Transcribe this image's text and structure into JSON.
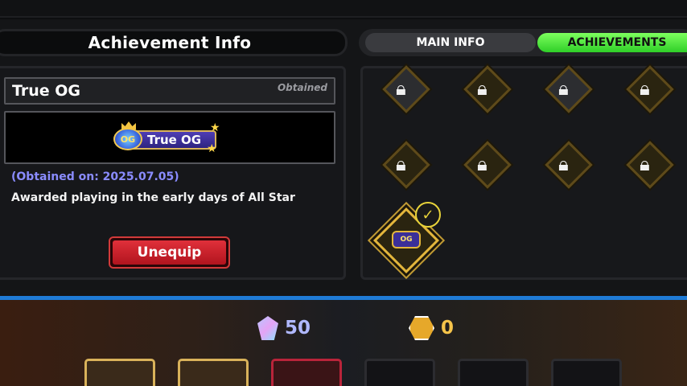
{
  "achievement_info": {
    "header": "Achievement Info",
    "title": "True OG",
    "status": "Obtained",
    "badge_label": "True OG",
    "badge_og": "OG",
    "obtained_on": "(Obtained on: 2025.07.05)",
    "description": "Awarded playing in the early days of All Star",
    "unequip_label": "Unequip"
  },
  "tabs": [
    {
      "label": "MAIN INFO",
      "active": false
    },
    {
      "label": "ACHIEVEMENTS",
      "active": true
    }
  ],
  "achievements_grid": {
    "rows": [
      [
        "lock-icon",
        "lock-icon",
        "lock-icon",
        "lock-icon"
      ],
      [
        "lock-icon",
        "lock-icon",
        "lock-icon",
        "lock-icon"
      ]
    ],
    "equipped": {
      "label": "OG",
      "checked": true
    }
  },
  "currency": {
    "gems": "50",
    "coins": "0"
  },
  "colors": {
    "accent_green": "#2fcf28",
    "unequip_red": "#e0303a",
    "date_purple": "#8a8cff",
    "gold": "#e3b63c"
  }
}
